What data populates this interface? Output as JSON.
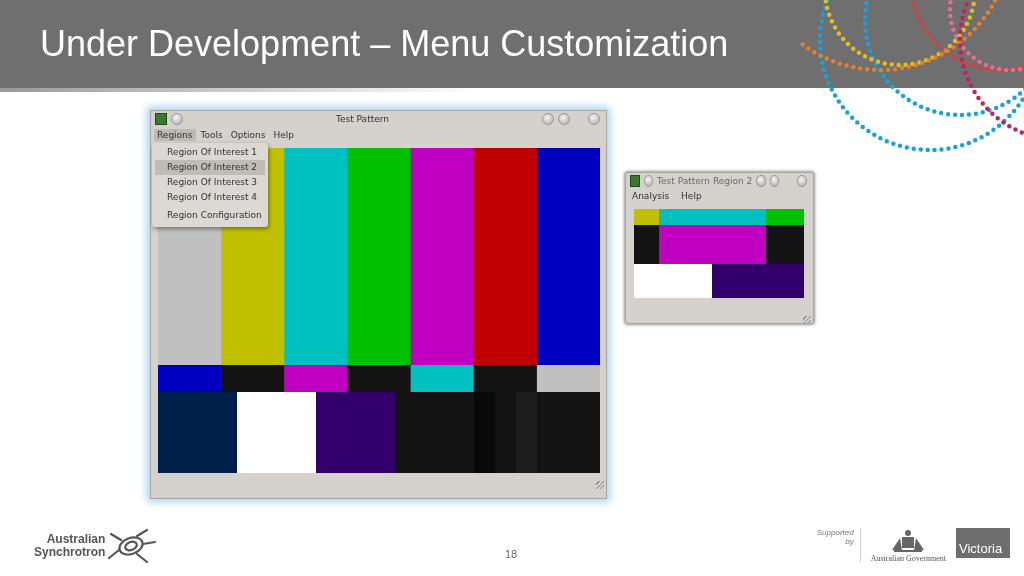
{
  "slide": {
    "title": "Under Development – Menu Customization",
    "page_number": "18"
  },
  "main_window": {
    "title": "Test Pattern",
    "menus": [
      {
        "label": "Regions",
        "selected": true
      },
      {
        "label": "Tools",
        "selected": false
      },
      {
        "label": "Options",
        "selected": false
      },
      {
        "label": "Help",
        "selected": false
      }
    ],
    "dropdown": [
      {
        "label": "Region Of Interest 1",
        "selected": false
      },
      {
        "label": "Region Of Interest 2",
        "selected": true
      },
      {
        "label": "Region Of Interest 3",
        "selected": false
      },
      {
        "label": "Region Of Interest 4",
        "selected": false
      },
      {
        "label": "Region Configuration",
        "selected": false
      }
    ]
  },
  "region_window": {
    "title": "Test Pattern Region 2",
    "menus": [
      {
        "label": "Analysis"
      },
      {
        "label": "Help"
      }
    ]
  },
  "footer": {
    "logo_line_1": "Australian",
    "logo_line_2": "Synchrotron",
    "supported": "Supported",
    "by": "by",
    "government": "Australian Government",
    "victoria": "Victoria"
  }
}
